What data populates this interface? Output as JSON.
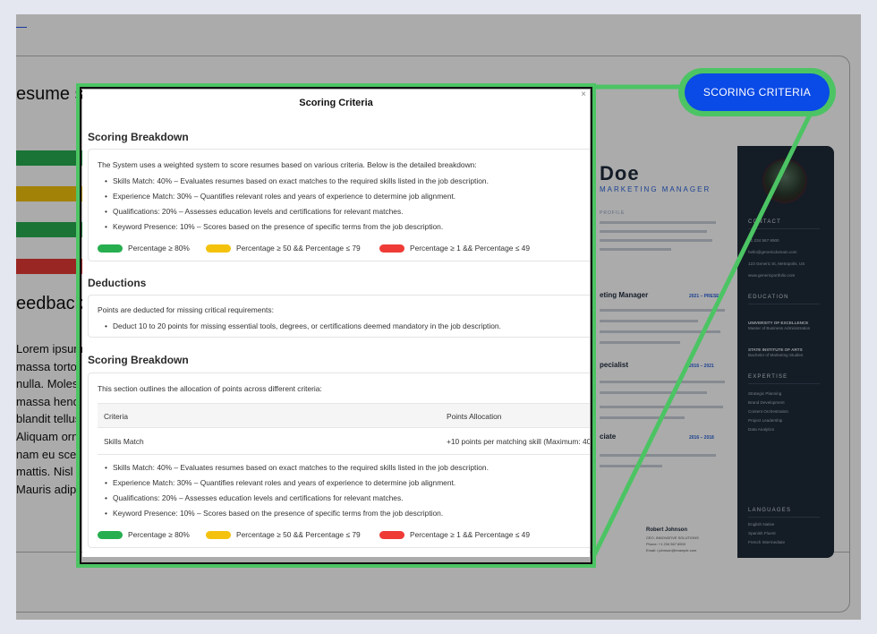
{
  "background": {
    "heading": "esume s",
    "feedback_heading": "eedback",
    "lorem_lines": [
      "Lorem ipsum",
      "massa torto",
      "nulla. Moles",
      "massa hend",
      "blandit tellus",
      "Aliquam orn",
      "nam eu scel",
      "mattis. Nisl",
      "Mauris adipi"
    ],
    "bar_colors": [
      "#27ae4f",
      "#f4c20d",
      "#27ae4f",
      "#e53935"
    ]
  },
  "resume": {
    "name": "Doe",
    "role": "MARKETING MANAGER",
    "section_profile": "PROFILE",
    "job1_title": "eting Manager",
    "job1_date": "2021 – PRESE",
    "job2_title": "pecialist",
    "job2_date": "2016 – 2021",
    "job3_title": "ciate",
    "job3_date": "2016 – 2018",
    "ref_name": "Robert Johnson",
    "ref_sub": "CEO, INNOVATIVE SOLUTIONS",
    "ref_phone": "Phone: +1 234 567 8900",
    "ref_email": "Email: r.johnson@example.com",
    "sidebar": {
      "contact_label": "CONTACT",
      "phone": "+1 234 567 8900",
      "email": "hello@genericdomain.com",
      "address": "123 Generic St, Metropolis, US",
      "website": "www.genericportfolio.com",
      "education_label": "EDUCATION",
      "edu1": "UNIVERSITY OF EXCELLENCE",
      "edu1_sub": "Master of Business Administration",
      "edu2": "STATE INSTITUTE OF ARTS",
      "edu2_sub": "Bachelor of Marketing Studies",
      "expertise_label": "EXPERTISE",
      "expertise": [
        "Strategic Planning",
        "Brand Development",
        "Content Orchestration",
        "Project Leadership",
        "Data Analytics"
      ],
      "languages_label": "LANGUAGES",
      "languages": [
        "English Native",
        "Spanish Fluent",
        "French Intermediate"
      ]
    }
  },
  "modal": {
    "title": "Scoring Criteria",
    "close": "×",
    "section1": {
      "heading": "Scoring Breakdown",
      "intro": "The System uses a weighted system to score resumes based on various criteria. Below is the detailed breakdown:",
      "bullets": [
        "Skills Match: 40% – Evaluates resumes based on exact matches to the required skills listed in the job description.",
        "Experience Match: 30% – Quantifies relevant roles and years of experience to determine job alignment.",
        "Qualifications: 20% – Assesses education levels and certifications for relevant matches.",
        "Keyword Presence: 10% – Scores based on the presence of specific terms from the job description."
      ]
    },
    "legend": [
      {
        "color": "#27ae4f",
        "label": "Percentage ≥ 80%"
      },
      {
        "color": "#f4c20d",
        "label": "Percentage ≥ 50 && Percentage ≤ 79"
      },
      {
        "color": "#ef3b36",
        "label": "Percentage ≥ 1 && Percentage ≤ 49"
      }
    ],
    "section2": {
      "heading": "Deductions",
      "intro": "Points are deducted for missing critical requirements:",
      "bullets": [
        "Deduct 10 to 20 points for missing essential tools, degrees, or certifications deemed mandatory in the job description."
      ]
    },
    "section3": {
      "heading": "Scoring Breakdown",
      "intro": "This section outlines the allocation of points across different criteria:",
      "table_headers": [
        "Criteria",
        "Points Allocation"
      ],
      "table_rows": [
        [
          "Skills Match",
          "+10 points per matching skill (Maximum: 40"
        ]
      ],
      "bullets": [
        "Skills Match: 40% – Evaluates resumes based on exact matches to the required skills listed in the job description.",
        "Experience Match: 30% – Quantifies relevant roles and years of experience to determine job alignment.",
        "Qualifications: 20% – Assesses education levels and certifications for relevant matches.",
        "Keyword Presence: 10% – Scores based on the presence of specific terms from the job description."
      ]
    }
  },
  "callout": {
    "button_label": "SCORING CRITERIA",
    "highlight_color": "#4cc464",
    "button_color": "#0a4ae6"
  }
}
